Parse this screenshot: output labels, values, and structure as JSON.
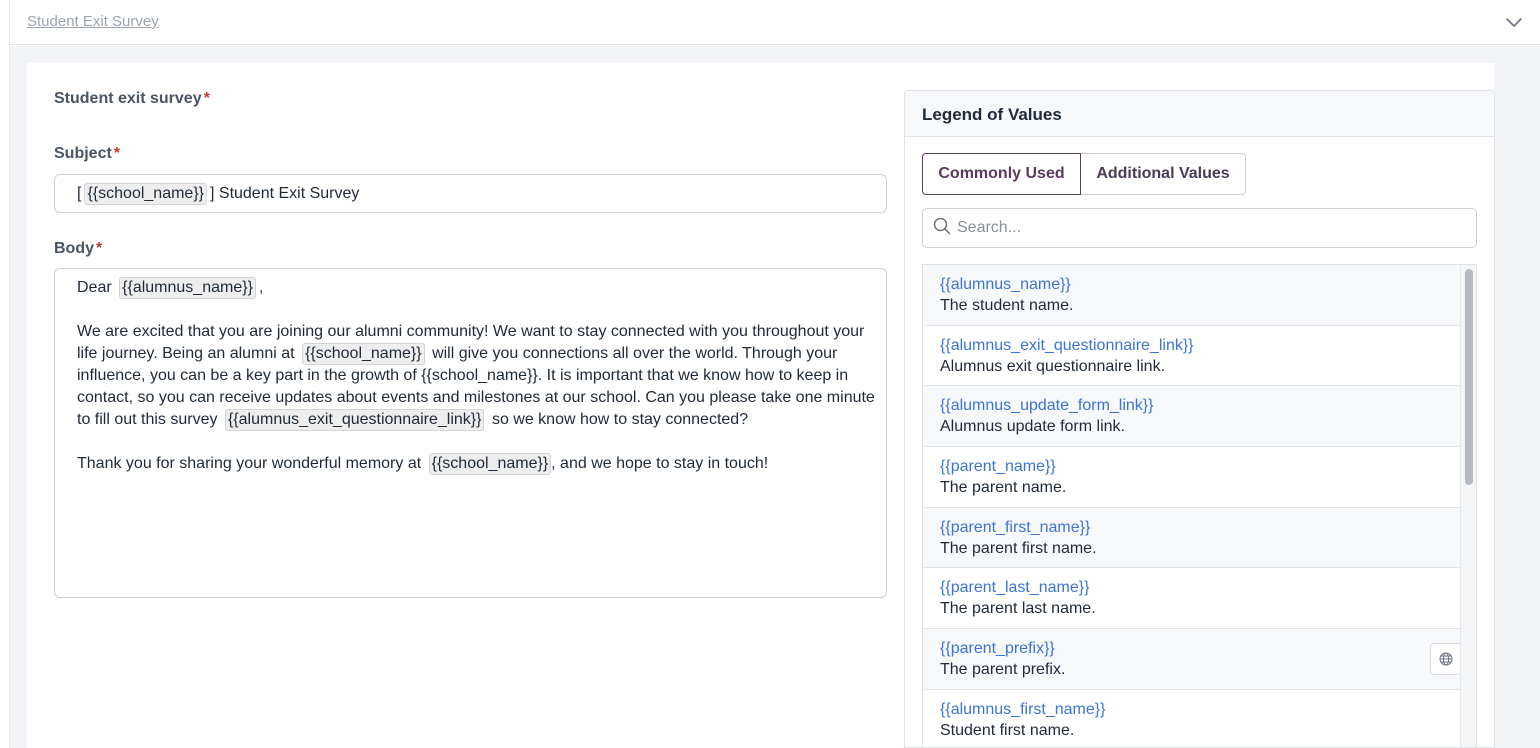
{
  "accordion": {
    "title": "Student Exit Survey"
  },
  "form": {
    "section_label": "Student exit survey",
    "required_mark": "*",
    "subject": {
      "label": "Subject",
      "prefix": "[",
      "token": "{{school_name}}",
      "suffix": "] Student Exit Survey"
    },
    "body": {
      "label": "Body",
      "greeting_prefix": "Dear",
      "greeting_token": "{{alumnus_name}}",
      "greeting_suffix": ",",
      "p1_a": "We are excited that you are joining our alumni community! We want to stay connected with you throughout your life journey. Being an alumni at",
      "p1_token1": "{{school_name}}",
      "p1_b": "will give you connections all over the world. Through your influence, you can be a key part in the growth of {{school_name}}. It is important that we know how to keep in contact, so you can receive updates about events and milestones at our school. Can you please take one minute to fill out this survey",
      "p1_token2": "{{alumnus_exit_questionnaire_link}}",
      "p1_c": "so we know how to stay connected?",
      "p2_a": "Thank you for sharing your wonderful memory at",
      "p2_token": "{{school_name}}",
      "p2_b": ", and we hope to stay in touch!"
    }
  },
  "legend": {
    "title": "Legend of Values",
    "tabs": [
      "Commonly Used",
      "Additional Values"
    ],
    "active_tab": "Commonly Used",
    "search_placeholder": "Search...",
    "items": [
      {
        "key": "{{alumnus_name}}",
        "desc": "The student name."
      },
      {
        "key": "{{alumnus_exit_questionnaire_link}}",
        "desc": "Alumnus exit questionnaire link."
      },
      {
        "key": "{{alumnus_update_form_link}}",
        "desc": "Alumnus update form link."
      },
      {
        "key": "{{parent_name}}",
        "desc": "The parent name."
      },
      {
        "key": "{{parent_first_name}}",
        "desc": "The parent first name."
      },
      {
        "key": "{{parent_last_name}}",
        "desc": "The parent last name."
      },
      {
        "key": "{{parent_prefix}}",
        "desc": "The parent prefix."
      },
      {
        "key": "{{alumnus_first_name}}",
        "desc": "Student first name."
      }
    ],
    "icons": {
      "search": "search-icon",
      "globe": "globe-icon",
      "chevron": "chevron-down-icon"
    }
  },
  "colors": {
    "link": "#3b74d4",
    "accent": "#5b3a5f",
    "required": "#c0392b"
  }
}
